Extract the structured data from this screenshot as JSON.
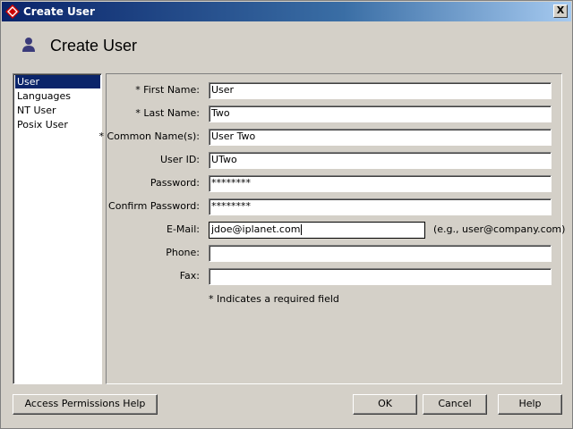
{
  "window": {
    "title": "Create User",
    "close_label": "X",
    "heading": "Create User"
  },
  "nav": {
    "items": [
      {
        "label": "User",
        "selected": true
      },
      {
        "label": "Languages",
        "selected": false
      },
      {
        "label": "NT User",
        "selected": false
      },
      {
        "label": "Posix User",
        "selected": false
      }
    ]
  },
  "form": {
    "first_name": {
      "label": "* First Name:",
      "value": "User"
    },
    "last_name": {
      "label": "* Last Name:",
      "value": "Two"
    },
    "common_name": {
      "label": "* Common Name(s):",
      "value": "User Two"
    },
    "user_id": {
      "label": "User ID:",
      "value": "UTwo"
    },
    "password": {
      "label": "Password:",
      "value": "********"
    },
    "confirm_password": {
      "label": "Confirm Password:",
      "value": "********"
    },
    "email": {
      "label": "E-Mail:",
      "value": "jdoe@iplanet.com",
      "hint": "(e.g., user@company.com)"
    },
    "phone": {
      "label": "Phone:",
      "value": ""
    },
    "fax": {
      "label": "Fax:",
      "value": ""
    },
    "required_note": "* Indicates a required field"
  },
  "buttons": {
    "help_access": "Access Permissions Help",
    "ok": "OK",
    "cancel": "Cancel",
    "help": "Help"
  },
  "icons": {
    "title": "app-diamond-icon",
    "header": "user-icon"
  },
  "colors": {
    "title_bar": "#0a246a",
    "selection": "#0a246a",
    "dialog_bg": "#d4d0c8"
  }
}
